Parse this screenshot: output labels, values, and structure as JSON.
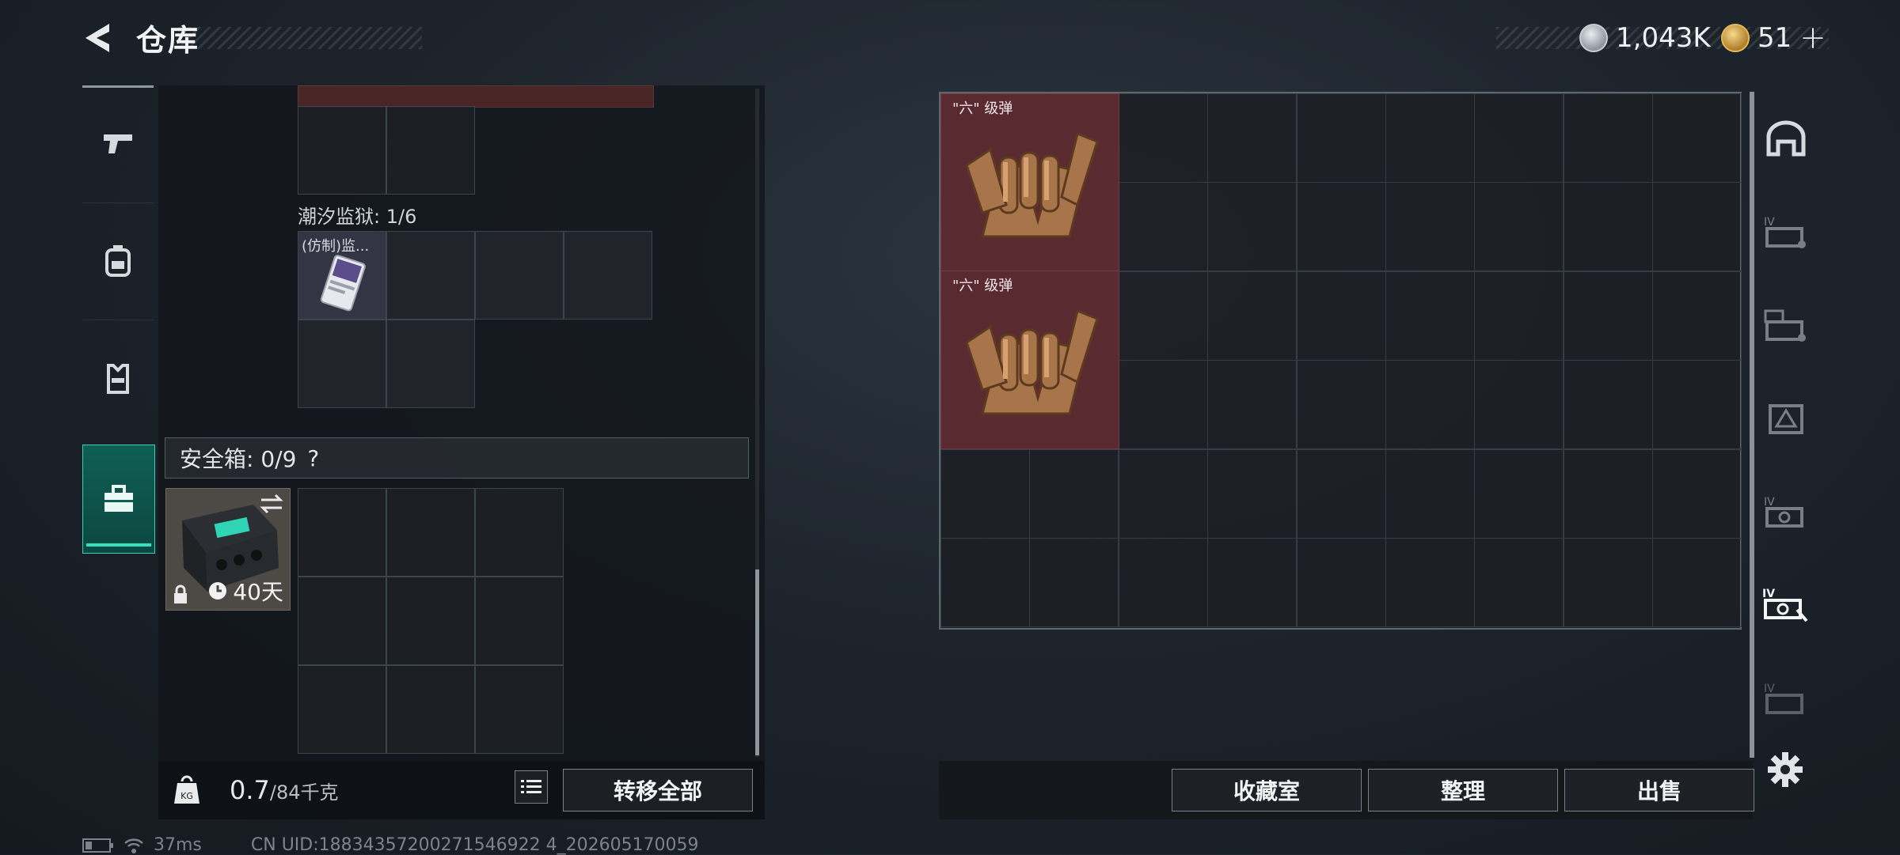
{
  "header": {
    "title": "仓库",
    "silver_amount": "1,043K",
    "gold_amount": "51"
  },
  "left": {
    "section_label": "潮汐监狱: 1/6",
    "card_item_name": "(仿制)监...",
    "safe_label": "安全箱: 0/9",
    "safe_help": "?",
    "safebox_days": "40天",
    "weight_value": "0.7",
    "weight_max": "/84千克",
    "transfer_all": "转移全部"
  },
  "right": {
    "item_tag_1": "\"六\" 级弹",
    "item_tag_2": "\"六\" 级弹",
    "btn_collection": "收藏室",
    "btn_sort": "整理",
    "btn_sell": "出售"
  },
  "status": {
    "ping": "37ms",
    "uid": "CN UID:18834357200271546922 4_202605170059"
  },
  "rail_icons": [
    "pistol-icon",
    "backpack-icon",
    "vest-icon",
    "case-icon"
  ],
  "right_rail_icons": [
    "arch-icon",
    "card-iv-icon",
    "card-g3-icon",
    "card-triangle-icon",
    "card-iv-2-icon",
    "card-iv-active-icon",
    "card-iv-3-icon"
  ]
}
